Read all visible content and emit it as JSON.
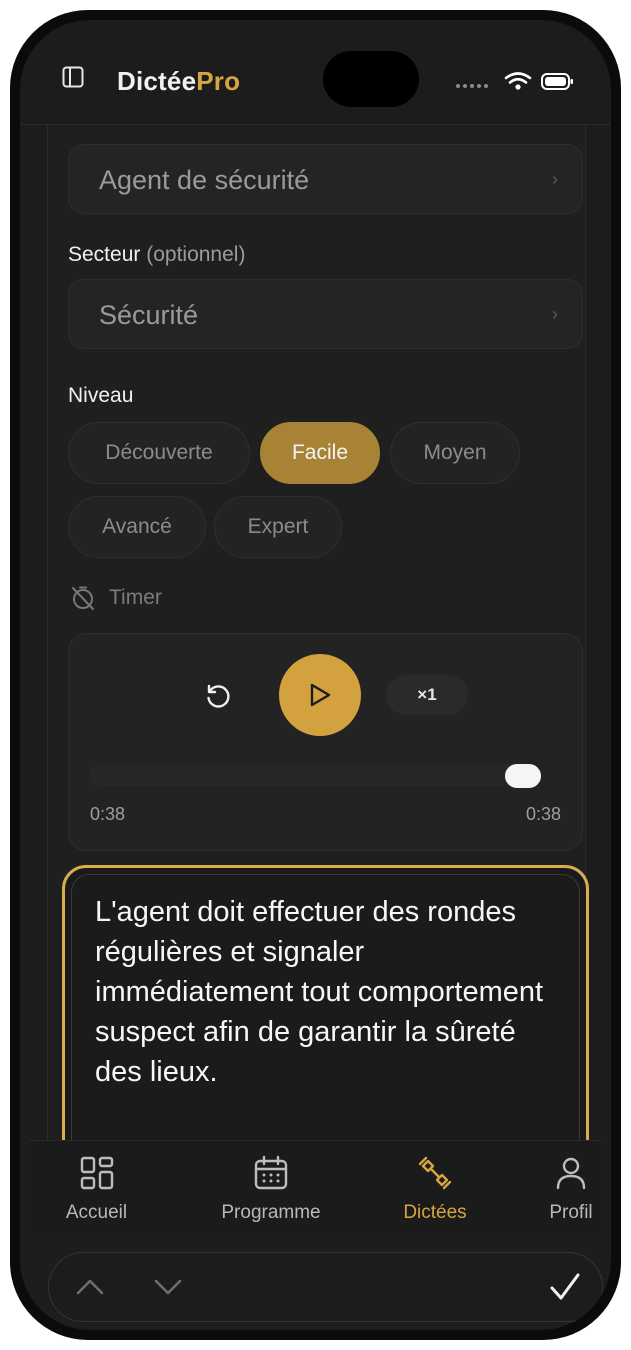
{
  "app": {
    "logo_part1": "Dictée",
    "logo_part2": "Pro",
    "accent": "#d6a541"
  },
  "form": {
    "poste_value": "Agent de sécurité",
    "secteur_label": "Secteur",
    "secteur_optional": "(optionnel)",
    "secteur_value": "Sécurité",
    "niveau_label": "Niveau",
    "levels": [
      "Découverte",
      "Facile",
      "Moyen",
      "Avancé",
      "Expert"
    ],
    "selected_level": "Facile",
    "timer_label": "Timer"
  },
  "player": {
    "speed": "×1",
    "elapsed": "0:38",
    "duration": "0:38",
    "progress": 1.0
  },
  "dictation": {
    "text": "L'agent doit effectuer des rondes régulières et signaler immédiatement tout comportement suspect afin de garantir la sûreté des lieux."
  },
  "tabs": [
    {
      "label": "Accueil",
      "icon": "grid-icon"
    },
    {
      "label": "Programme",
      "icon": "calendar-icon"
    },
    {
      "label": "Dictées",
      "icon": "dumbbell-icon",
      "active": true
    },
    {
      "label": "Profil",
      "icon": "user-icon"
    }
  ]
}
